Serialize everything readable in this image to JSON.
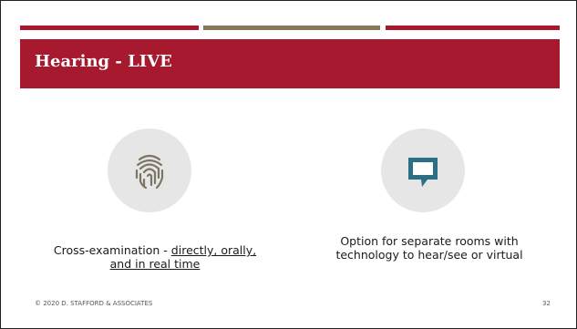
{
  "slide": {
    "title": "Hearing - LIVE",
    "colors": {
      "accent": "#a6192e",
      "divider_mid": "#857a54",
      "icon_bubble": "#2a6f84"
    },
    "items": [
      {
        "icon": "fingerprint-icon",
        "caption_prefix": "Cross-examination - ",
        "caption_underlined_line1": "directly, orally,",
        "caption_underlined_line2": "and in real time"
      },
      {
        "icon": "speech-bubble-icon",
        "caption_line1": "Option for separate rooms with",
        "caption_line2": "technology to hear/see or virtual"
      }
    ],
    "footer_left": "© 2020 D. STAFFORD & ASSOCIATES",
    "page_number": "32"
  }
}
